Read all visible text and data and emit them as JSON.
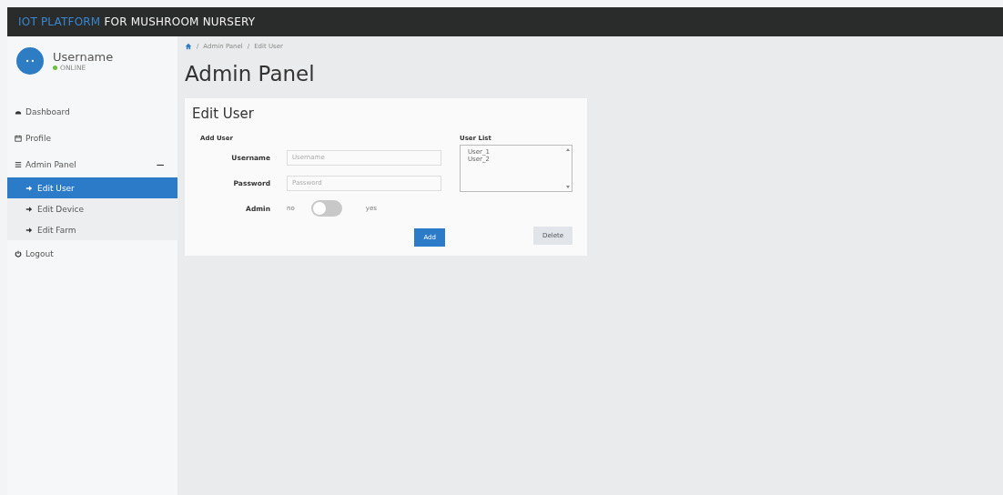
{
  "brand": {
    "highlight": "IOT PLATFORM",
    "rest": "FOR MUSHROOM NURSERY"
  },
  "user": {
    "name": "Username",
    "status": "ONLINE"
  },
  "menu": [
    {
      "label": "Dashboard",
      "selected": false
    },
    {
      "label": "Profile",
      "selected": false
    },
    {
      "label": "Admin Panel",
      "selected": false,
      "expanded": true,
      "toggle": "−",
      "children": [
        {
          "label": "Edit User",
          "selected": true
        },
        {
          "label": "Edit Device",
          "selected": false
        },
        {
          "label": "Edit Farm",
          "selected": false
        }
      ]
    },
    {
      "label": "Logout",
      "selected": false
    }
  ],
  "breadcrumb": {
    "items": [
      "Admin Panel",
      "Edit User"
    ],
    "separators": [
      "/",
      "/"
    ]
  },
  "page_title": "Admin Panel",
  "card": {
    "title": "Edit User",
    "section": "Add User",
    "fields": [
      {
        "label": "Username",
        "placeholder": "Username"
      },
      {
        "label": "Password",
        "placeholder": "Password"
      }
    ],
    "admin": {
      "label": "Admin",
      "off_label": "no",
      "on_label": "yes",
      "on": false
    },
    "user_list": {
      "label": "User List",
      "items": [
        "User_1",
        "User_2"
      ]
    },
    "buttons": {
      "add": "Add",
      "delete": "Delete"
    }
  }
}
